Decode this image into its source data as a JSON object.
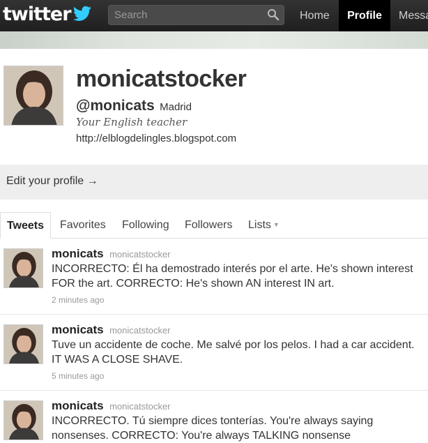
{
  "brand": {
    "logo_text": "twitter",
    "accent": "#33ccff"
  },
  "search": {
    "placeholder": "Search"
  },
  "nav": {
    "home": "Home",
    "profile": "Profile",
    "messages": "Messa"
  },
  "profile": {
    "username": "monicatstocker",
    "handle": "@monicats",
    "location": "Madrid",
    "bio": "Your English teacher",
    "url": "http://elblogdelingles.blogspot.com"
  },
  "edit_profile": "Edit your profile →",
  "tabs": [
    "Tweets",
    "Favorites",
    "Following",
    "Followers",
    "Lists"
  ],
  "tweets": [
    {
      "name": "monicats",
      "screen_name": "monicatstocker",
      "text": "INCORRECTO: Él ha demostrado interés por el arte. He's shown interest FOR the art. CORRECTO: He's shown AN interest IN art.",
      "time": "2 minutes ago"
    },
    {
      "name": "monicats",
      "screen_name": "monicatstocker",
      "text": "Tuve un accidente de coche. Me salvé por los pelos. I had a car accident. IT WAS A CLOSE SHAVE.",
      "time": "5 minutes ago"
    },
    {
      "name": "monicats",
      "screen_name": "monicatstocker",
      "text": "INCORRECTO. Tú siempre dices tonterías. You're always saying nonsenses. CORRECTO: You're always TALKING nonsense",
      "time": ""
    }
  ]
}
